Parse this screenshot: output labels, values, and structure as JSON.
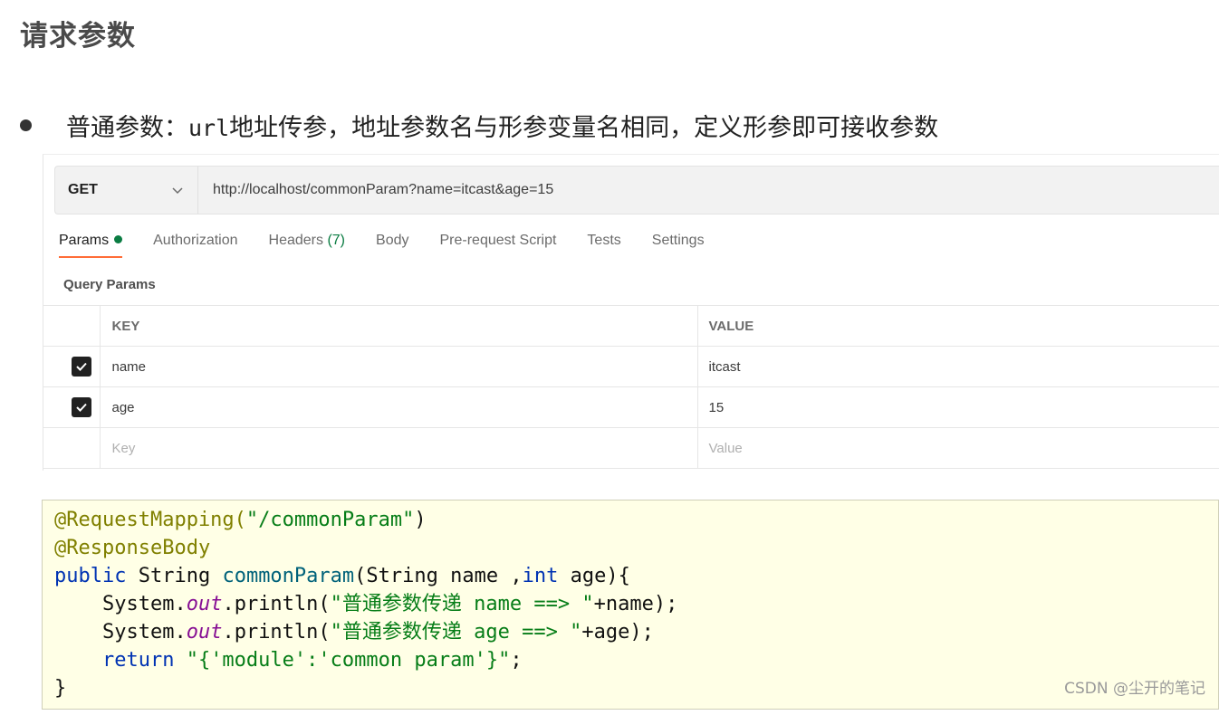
{
  "heading": "请求参数",
  "bullet": {
    "prefix": "普通参数：",
    "mono": "url",
    "text": "地址传参，地址参数名与形参变量名相同，定义形参即可接收参数"
  },
  "request": {
    "method": "GET",
    "url": "http://localhost/commonParam?name=itcast&age=15"
  },
  "tabs": [
    {
      "label": "Params",
      "active": true
    },
    {
      "label": "Authorization"
    },
    {
      "label": "Headers",
      "count": "(7)"
    },
    {
      "label": "Body"
    },
    {
      "label": "Pre-request Script"
    },
    {
      "label": "Tests"
    },
    {
      "label": "Settings"
    }
  ],
  "query_params": {
    "title": "Query Params",
    "headers": {
      "key": "KEY",
      "value": "VALUE"
    },
    "rows": [
      {
        "key": "name",
        "value": "itcast",
        "checked": true
      },
      {
        "key": "age",
        "value": "15",
        "checked": true
      }
    ],
    "placeholder": {
      "key": "Key",
      "value": "Value"
    }
  },
  "code": {
    "l1_ann": "@RequestMapping(",
    "l1_str": "\"/commonParam\"",
    "l1_end": ")",
    "l2_ann": "@ResponseBody",
    "l3_kw": "public",
    "l3_type": " String ",
    "l3_fn": "commonParam",
    "l3_args": "(String name ,",
    "l3_kw2": "int",
    "l3_end": " age){",
    "l4_a": "    System.",
    "l4_out": "out",
    "l4_b": ".println(",
    "l4_str": "\"普通参数传递 name ==> \"",
    "l4_end": "+name);",
    "l5_a": "    System.",
    "l5_out": "out",
    "l5_b": ".println(",
    "l5_str": "\"普通参数传递 age ==> \"",
    "l5_end": "+age);",
    "l6_kw": "    return",
    "l6_str": " \"{'module':'common param'}\"",
    "l6_end": ";",
    "l7": "}"
  },
  "watermark": "CSDN @尘开的笔记"
}
